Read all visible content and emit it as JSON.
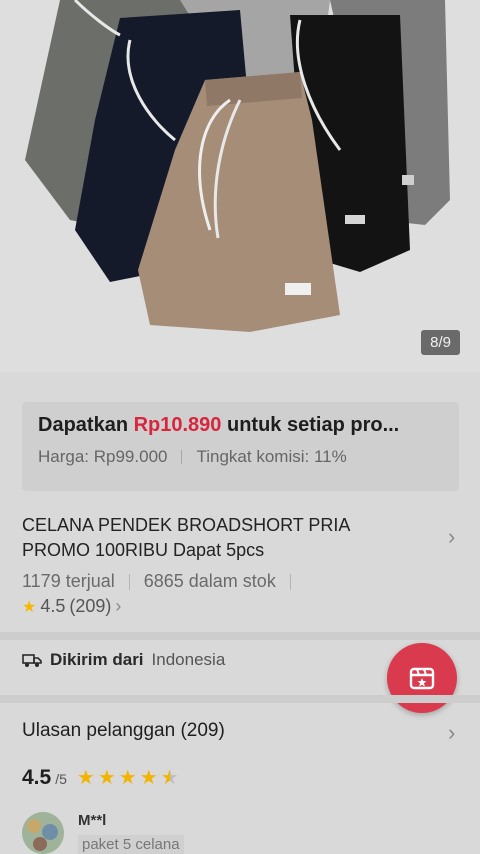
{
  "gallery": {
    "counter": "8/9"
  },
  "promo": {
    "prefix": "Dapatkan",
    "amount": "Rp10.890",
    "suffix": "untuk setiap pro...",
    "price": "Harga: Rp99.000",
    "commission": "Tingkat komisi: 11%",
    "accent_color": "#d7263d"
  },
  "product": {
    "title_line1": "CELANA PENDEK BROADSHORT PRIA",
    "title_line2": "PROMO 100RIBU Dapat 5pcs",
    "sold": "1179 terjual",
    "stock": "6865 dalam stok",
    "rating": "4.5",
    "rating_count": "(209)"
  },
  "shipping": {
    "label": "Dikirim dari",
    "location": "Indonesia",
    "icon": "truck-icon"
  },
  "fab": {
    "icon": "calendar-star-icon",
    "color": "#d93a4e"
  },
  "reviews": {
    "title": "Ulasan pelanggan (209)",
    "score": "4.5",
    "out_of": "/5",
    "stars": 4.5,
    "first": {
      "name": "M**l",
      "variant": "paket 5 celana"
    }
  }
}
